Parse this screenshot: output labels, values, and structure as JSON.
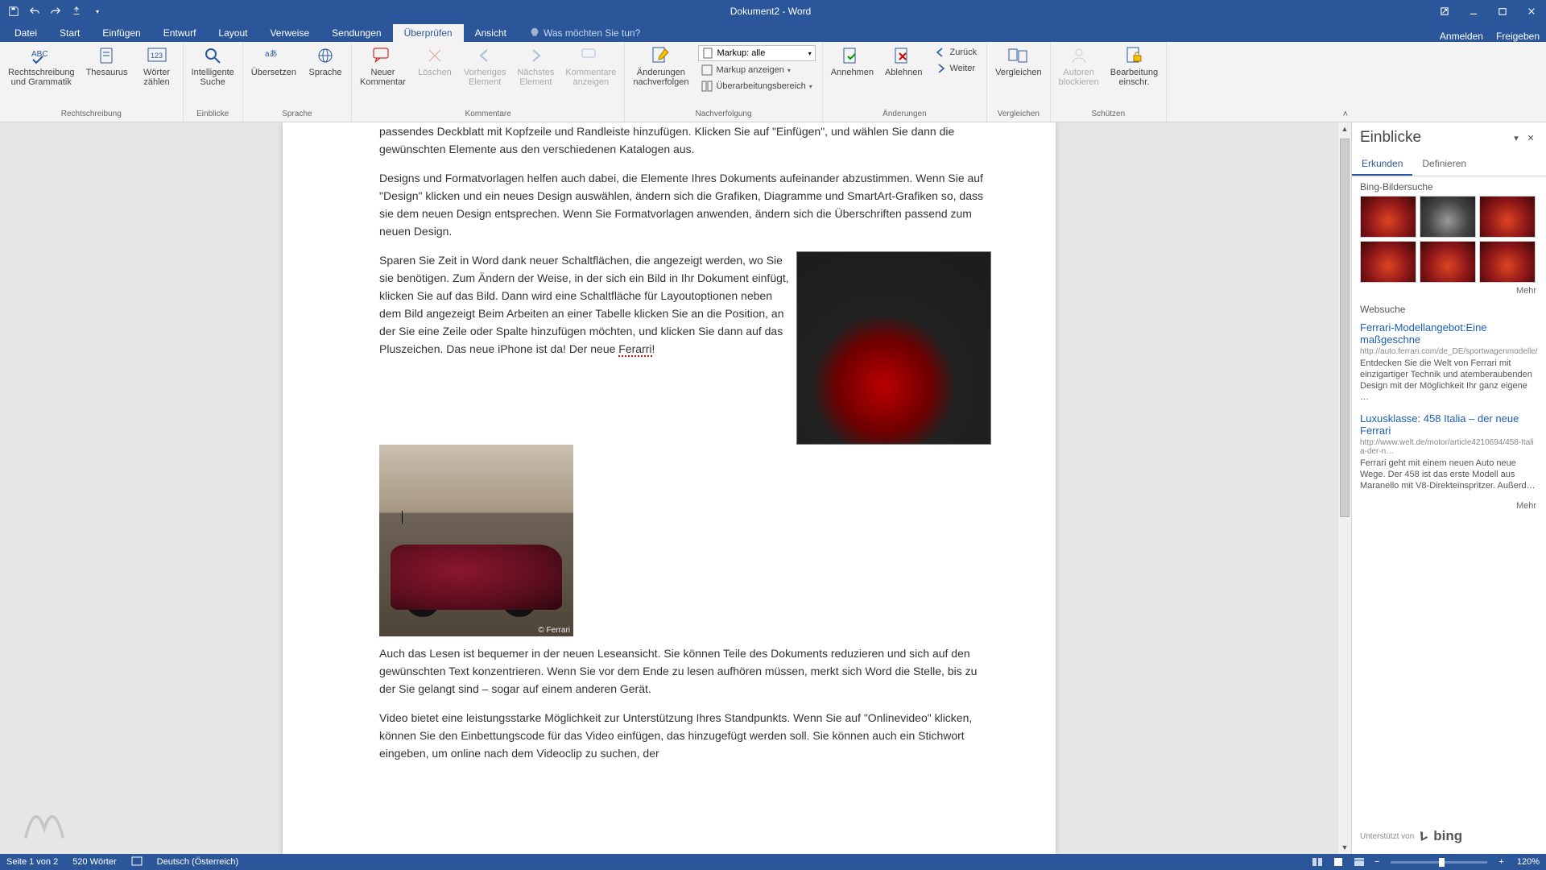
{
  "title": "Dokument2 - Word",
  "qat": {
    "save": "save-icon",
    "undo": "undo-icon",
    "redo": "redo-icon",
    "touch": "touch-icon",
    "customize": "customize-icon"
  },
  "tabs": {
    "items": [
      "Datei",
      "Start",
      "Einfügen",
      "Entwurf",
      "Layout",
      "Verweise",
      "Sendungen",
      "Überprüfen",
      "Ansicht"
    ],
    "active_index": 7,
    "tell_me_placeholder": "Was möchten Sie tun?",
    "right": {
      "signin": "Anmelden",
      "share": "Freigeben"
    }
  },
  "ribbon": {
    "groups": [
      {
        "label": "Rechtschreibung",
        "items": [
          {
            "label": "Rechtschreibung\nund Grammatik"
          },
          {
            "label": "Thesaurus"
          },
          {
            "label": "Wörter\nzählen"
          }
        ]
      },
      {
        "label": "Einblicke",
        "items": [
          {
            "label": "Intelligente\nSuche"
          }
        ]
      },
      {
        "label": "Sprache",
        "items": [
          {
            "label": "Übersetzen"
          },
          {
            "label": "Sprache"
          }
        ]
      },
      {
        "label": "Kommentare",
        "items": [
          {
            "label": "Neuer\nKommentar"
          },
          {
            "label": "Löschen",
            "disabled": true
          },
          {
            "label": "Vorheriges\nElement",
            "disabled": true
          },
          {
            "label": "Nächstes\nElement",
            "disabled": true
          },
          {
            "label": "Kommentare\nanzeigen",
            "disabled": true
          }
        ]
      },
      {
        "label": "Nachverfolgung",
        "items": [],
        "extras": {
          "track": "Änderungen\nnachverfolgen",
          "markup_dd": "Markup: alle",
          "show_markup": "Markup anzeigen",
          "review_pane": "Überarbeitungsbereich"
        }
      },
      {
        "label": "Änderungen",
        "items": [
          {
            "label": "Annehmen"
          },
          {
            "label": "Ablehnen"
          }
        ],
        "extras": {
          "prev": "Zurück",
          "next": "Weiter"
        }
      },
      {
        "label": "Vergleichen",
        "items": [
          {
            "label": "Vergleichen"
          }
        ]
      },
      {
        "label": "Schützen",
        "items": [
          {
            "label": "Autoren\nblockieren",
            "disabled": true
          },
          {
            "label": "Bearbeitung\neinschr."
          }
        ]
      }
    ]
  },
  "document": {
    "p1": "passendes Deckblatt mit Kopfzeile und Randleiste hinzufügen. Klicken Sie auf \"Einfügen\", und wählen Sie dann die gewünschten Elemente aus den verschiedenen Katalogen aus.",
    "p2": "Designs und Formatvorlagen helfen auch dabei, die Elemente Ihres Dokuments aufeinander abzustimmen. Wenn Sie auf \"Design\" klicken und ein neues Design auswählen, ändern sich die Grafiken, Diagramme und SmartArt-Grafiken so, dass sie dem neuen Design entsprechen. Wenn Sie Formatvorlagen anwenden, ändern sich die Überschriften passend zum neuen Design.",
    "p3a": "Sparen Sie Zeit in Word dank neuer Schaltflächen, die angezeigt werden, wo Sie sie benötigen. Zum Ändern der Weise, in der sich ein Bild in Ihr Dokument einfügt, klicken Sie auf das Bild. Dann wird eine Schaltfläche für Layoutoptionen neben dem Bild angezeigt Beim Arbeiten an einer Tabelle klicken Sie an die Position, an der Sie eine Zeile oder Spalte hinzufügen möchten, und klicken Sie dann auf das Pluszeichen. Das neue iPhone ist da! Der neue ",
    "p3b_err": "Ferarri",
    "p3c": "!",
    "img2_caption": "© Ferrari",
    "p4": "Auch das Lesen ist bequemer in der neuen Leseansicht. Sie können Teile des Dokuments reduzieren und sich auf den gewünschten Text konzentrieren. Wenn Sie vor dem Ende zu lesen aufhören müssen, merkt sich Word die Stelle, bis zu der Sie gelangt sind – sogar auf einem anderen Gerät.",
    "p5": "Video bietet eine leistungsstarke Möglichkeit zur Unterstützung Ihres Standpunkts. Wenn Sie auf \"Onlinevideo\" klicken, können Sie den Einbettungscode für das Video einfügen, das hinzugefügt werden soll. Sie können auch ein Stichwort eingeben, um online nach dem Videoclip zu suchen, der"
  },
  "insights": {
    "title": "Einblicke",
    "tabs": {
      "explore": "Erkunden",
      "define": "Definieren",
      "active": 0
    },
    "images_title": "Bing-Bildersuche",
    "more": "Mehr",
    "web_title": "Websuche",
    "results": [
      {
        "title": "Ferrari-Modellangebot:Eine maßgeschne",
        "url": "http://auto.ferrari.com/de_DE/sportwagenmodelle/",
        "desc": "Entdecken Sie die Welt von Ferrari mit einzigartiger Technik und atemberaubenden Design mit der Möglichkeit Ihr ganz eigene …"
      },
      {
        "title": "Luxusklasse: 458 Italia – der neue Ferrari",
        "url": "http://www.welt.de/motor/article4210694/458-Italia-der-n…",
        "desc": "Ferrari geht mit einem neuen Auto neue Wege. Der 458 ist das erste Modell aus Maranello mit V8-Direkteinspritzer. Außerd…"
      }
    ],
    "powered": "Unterstützt von",
    "bing": "bing"
  },
  "status": {
    "page": "Seite 1 von 2",
    "words": "520 Wörter",
    "lang": "Deutsch (Österreich)",
    "zoom": "120%"
  }
}
